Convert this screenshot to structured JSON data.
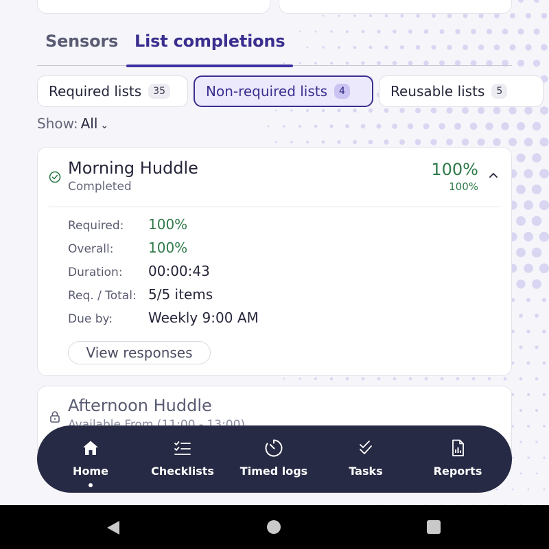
{
  "tabs": {
    "sensors": "Sensors",
    "list_completions": "List completions"
  },
  "filters": [
    {
      "label": "Required lists",
      "count": "35"
    },
    {
      "label": "Non-required lists",
      "count": "4"
    },
    {
      "label": "Reusable lists",
      "count": "5"
    }
  ],
  "show": {
    "label": "Show:",
    "value": "All"
  },
  "card": {
    "title": "Morning Huddle",
    "status": "Completed",
    "percent_main": "100%",
    "percent_small": "100%",
    "rows": [
      {
        "label": "Required:",
        "value": "100%"
      },
      {
        "label": "Overall:",
        "value": "100%"
      },
      {
        "label": "Duration:",
        "value": "00:00:43"
      },
      {
        "label": "Req. / Total:",
        "value": "5/5 items"
      },
      {
        "label": "Due by:",
        "value": "Weekly 9:00 AM"
      }
    ],
    "view_button": "View responses"
  },
  "card2": {
    "title": "Afternoon Huddle",
    "subtitle": "Available From (11:00 - 13:00)"
  },
  "nav": {
    "home": "Home",
    "checklists": "Checklists",
    "timed_logs": "Timed logs",
    "tasks": "Tasks",
    "reports": "Reports"
  },
  "colors": {
    "accent": "#3a2f8f",
    "success": "#2f7a49",
    "nav_bg": "#272a44"
  }
}
